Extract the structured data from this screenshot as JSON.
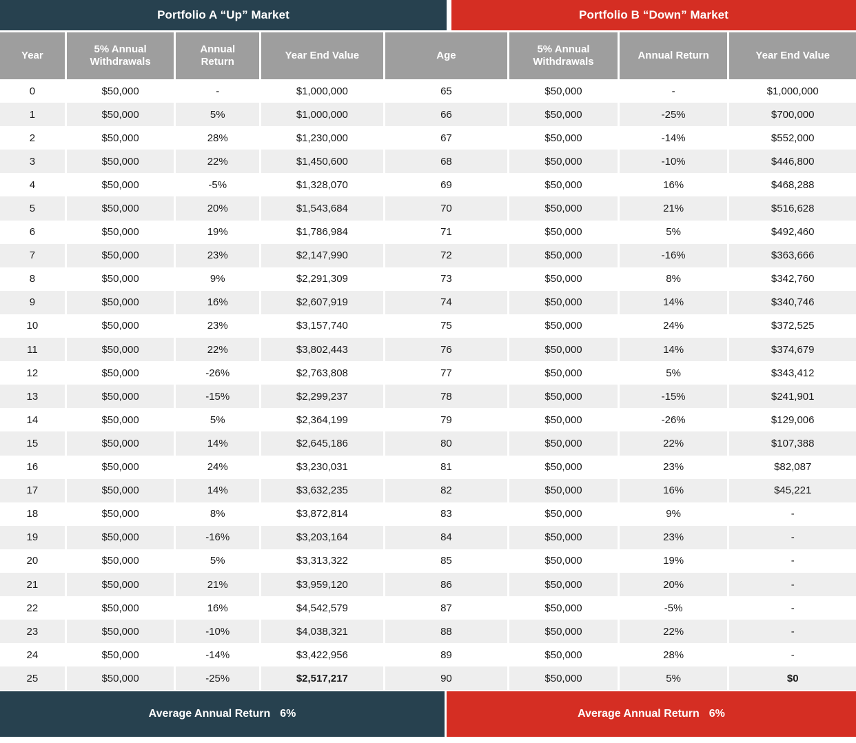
{
  "panels": {
    "left": {
      "title": "Portfolio A “Up” Market",
      "color": "#27414f",
      "columns": [
        "Year",
        "5% Annual Withdrawals",
        "Annual Return",
        "Year End Value"
      ],
      "column_labels": {
        "c0": "Year",
        "c1_line1": "5% Annual",
        "c1_line2": "Withdrawals",
        "c2_line1": "Annual",
        "c2_line2": "Return",
        "c3": "Year End Value"
      },
      "footer_label": "Average Annual Return",
      "footer_value": "6%"
    },
    "right": {
      "title": "Portfolio B “Down” Market",
      "color": "#d52e23",
      "columns": [
        "Age",
        "5% Annual Withdrawals",
        "Annual Return",
        "Year End Value"
      ],
      "column_labels": {
        "c4": "Age",
        "c5_line1": "5% Annual",
        "c5_line2": "Withdrawals",
        "c6": "Annual Return",
        "c7": "Year End Value"
      },
      "footer_label": "Average Annual Return",
      "footer_value": "6%"
    }
  },
  "chart_data": {
    "type": "table",
    "title": "Portfolio A “Up” Market vs Portfolio B “Down” Market",
    "columns": [
      "Year",
      "5% Annual Withdrawals",
      "Annual Return",
      "Year End Value",
      "Age",
      "5% Annual Withdrawals",
      "Annual Return",
      "Year End Value"
    ],
    "rows": [
      [
        "0",
        "$50,000",
        "-",
        "$1,000,000",
        "65",
        "$50,000",
        "-",
        "$1,000,000"
      ],
      [
        "1",
        "$50,000",
        "5%",
        "$1,000,000",
        "66",
        "$50,000",
        "-25%",
        "$700,000"
      ],
      [
        "2",
        "$50,000",
        "28%",
        "$1,230,000",
        "67",
        "$50,000",
        "-14%",
        "$552,000"
      ],
      [
        "3",
        "$50,000",
        "22%",
        "$1,450,600",
        "68",
        "$50,000",
        "-10%",
        "$446,800"
      ],
      [
        "4",
        "$50,000",
        "-5%",
        "$1,328,070",
        "69",
        "$50,000",
        "16%",
        "$468,288"
      ],
      [
        "5",
        "$50,000",
        "20%",
        "$1,543,684",
        "70",
        "$50,000",
        "21%",
        "$516,628"
      ],
      [
        "6",
        "$50,000",
        "19%",
        "$1,786,984",
        "71",
        "$50,000",
        "5%",
        "$492,460"
      ],
      [
        "7",
        "$50,000",
        "23%",
        "$2,147,990",
        "72",
        "$50,000",
        "-16%",
        "$363,666"
      ],
      [
        "8",
        "$50,000",
        "9%",
        "$2,291,309",
        "73",
        "$50,000",
        "8%",
        "$342,760"
      ],
      [
        "9",
        "$50,000",
        "16%",
        "$2,607,919",
        "74",
        "$50,000",
        "14%",
        "$340,746"
      ],
      [
        "10",
        "$50,000",
        "23%",
        "$3,157,740",
        "75",
        "$50,000",
        "24%",
        "$372,525"
      ],
      [
        "11",
        "$50,000",
        "22%",
        "$3,802,443",
        "76",
        "$50,000",
        "14%",
        "$374,679"
      ],
      [
        "12",
        "$50,000",
        "-26%",
        "$2,763,808",
        "77",
        "$50,000",
        "5%",
        "$343,412"
      ],
      [
        "13",
        "$50,000",
        "-15%",
        "$2,299,237",
        "78",
        "$50,000",
        "-15%",
        "$241,901"
      ],
      [
        "14",
        "$50,000",
        "5%",
        "$2,364,199",
        "79",
        "$50,000",
        "-26%",
        "$129,006"
      ],
      [
        "15",
        "$50,000",
        "14%",
        "$2,645,186",
        "80",
        "$50,000",
        "22%",
        "$107,388"
      ],
      [
        "16",
        "$50,000",
        "24%",
        "$3,230,031",
        "81",
        "$50,000",
        "23%",
        "$82,087"
      ],
      [
        "17",
        "$50,000",
        "14%",
        "$3,632,235",
        "82",
        "$50,000",
        "16%",
        "$45,221"
      ],
      [
        "18",
        "$50,000",
        "8%",
        "$3,872,814",
        "83",
        "$50,000",
        "9%",
        "-"
      ],
      [
        "19",
        "$50,000",
        "-16%",
        "$3,203,164",
        "84",
        "$50,000",
        "23%",
        "-"
      ],
      [
        "20",
        "$50,000",
        "5%",
        "$3,313,322",
        "85",
        "$50,000",
        "19%",
        "-"
      ],
      [
        "21",
        "$50,000",
        "21%",
        "$3,959,120",
        "86",
        "$50,000",
        "20%",
        "-"
      ],
      [
        "22",
        "$50,000",
        "16%",
        "$4,542,579",
        "87",
        "$50,000",
        "-5%",
        "-"
      ],
      [
        "23",
        "$50,000",
        "-10%",
        "$4,038,321",
        "88",
        "$50,000",
        "22%",
        "-"
      ],
      [
        "24",
        "$50,000",
        "-14%",
        "$3,422,956",
        "89",
        "$50,000",
        "28%",
        "-"
      ],
      [
        "25",
        "$50,000",
        "-25%",
        "$2,517,217",
        "90",
        "$50,000",
        "5%",
        "$0"
      ]
    ],
    "bold_cells": [
      [
        25,
        3
      ],
      [
        25,
        7
      ]
    ],
    "summary": {
      "portfolio_a_average_annual_return": "6%",
      "portfolio_b_average_annual_return": "6%",
      "starting_value": "$1,000,000",
      "annual_withdrawal": "$50,000",
      "portfolio_a_final_value": "$2,517,217",
      "portfolio_b_final_value": "$0"
    }
  }
}
